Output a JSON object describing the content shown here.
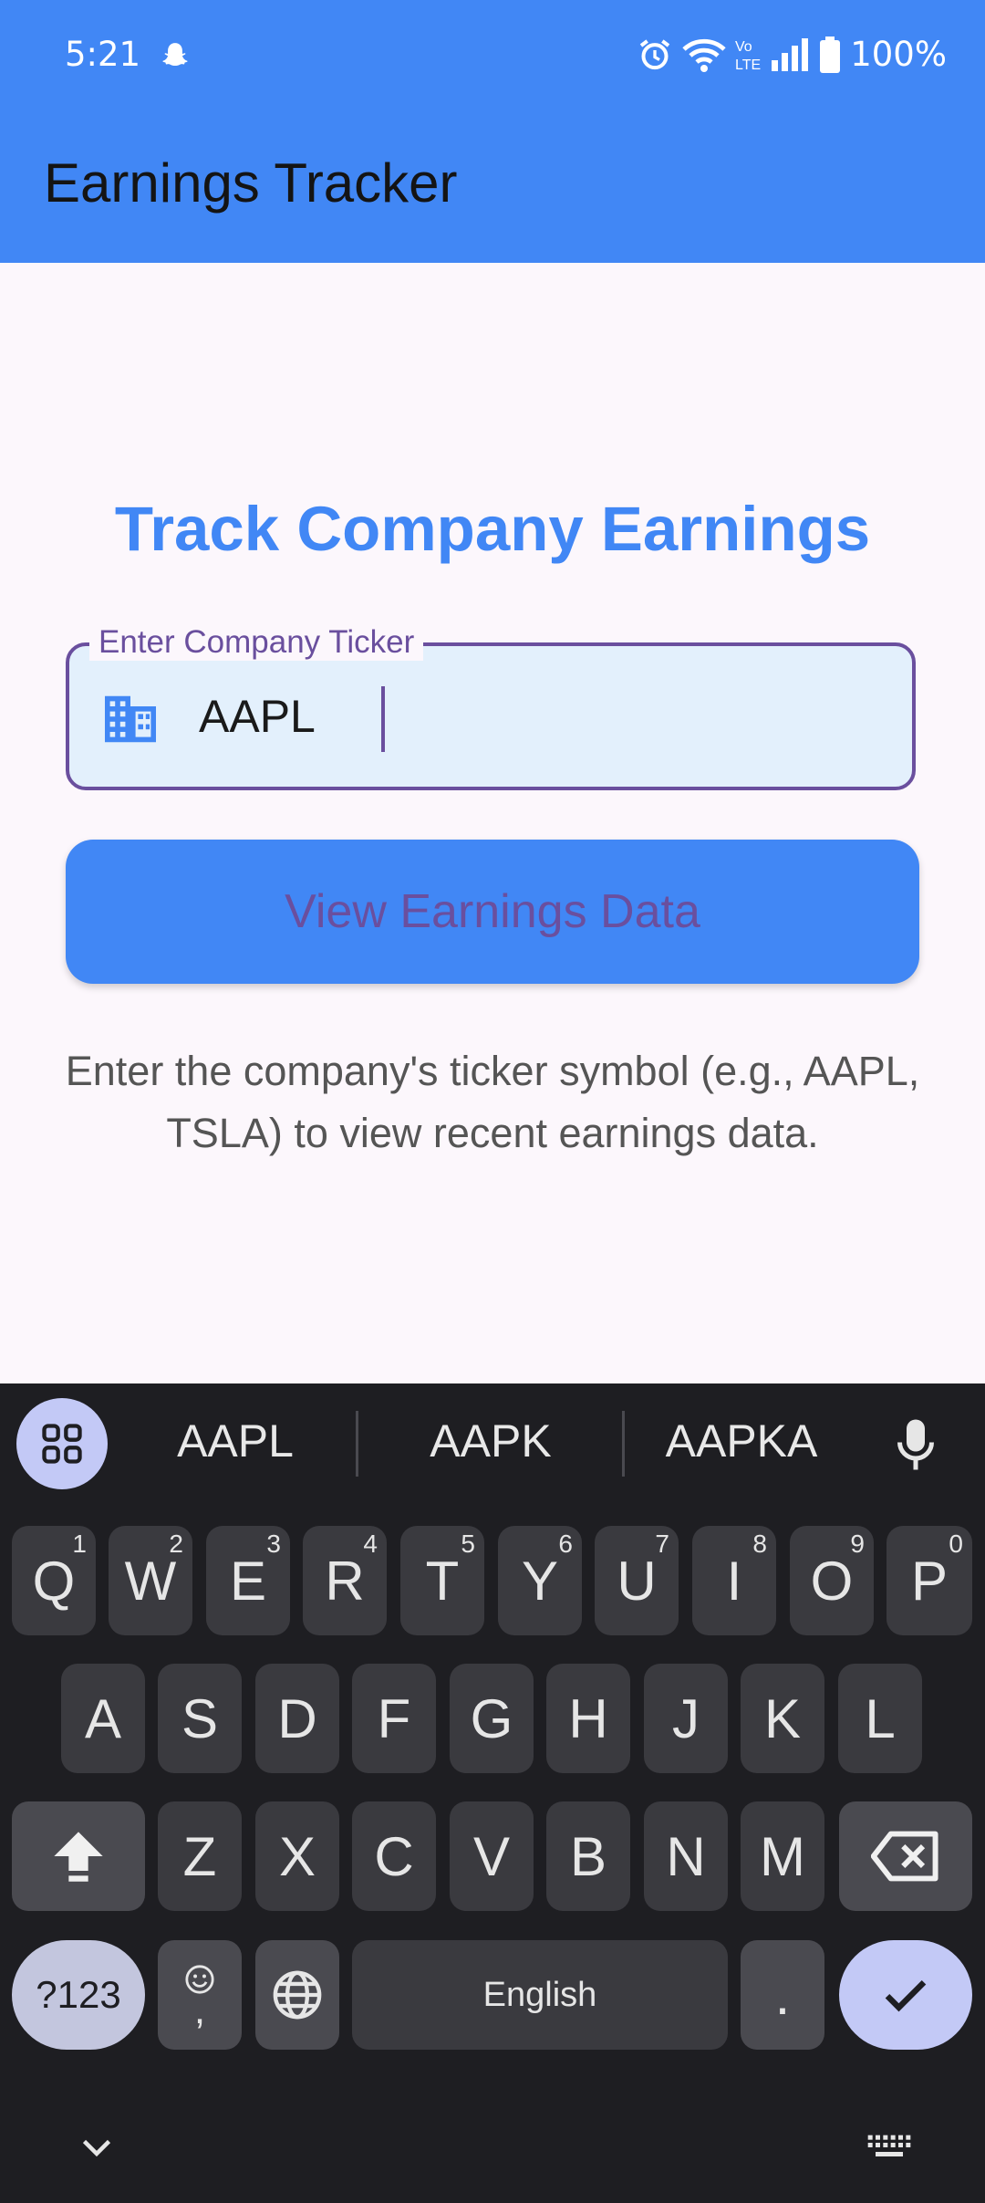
{
  "status_bar": {
    "time": "5:21",
    "battery": "100%",
    "icons": [
      "snapchat-icon",
      "alarm-icon",
      "wifi-icon",
      "volte-icon",
      "signal-icon",
      "battery-icon"
    ]
  },
  "app_bar": {
    "title": "Earnings Tracker"
  },
  "main": {
    "heading": "Track Company Earnings",
    "ticker_field": {
      "label": "Enter Company Ticker",
      "value": "AAPL",
      "icon": "building-icon"
    },
    "view_button_label": "View Earnings Data",
    "help_text": "Enter the company's ticker symbol (e.g., AAPL, TSLA) to view recent earnings data."
  },
  "keyboard": {
    "suggestions": [
      "AAPL",
      "AAPK",
      "AAPKA"
    ],
    "row1": [
      {
        "k": "Q",
        "s": "1"
      },
      {
        "k": "W",
        "s": "2"
      },
      {
        "k": "E",
        "s": "3"
      },
      {
        "k": "R",
        "s": "4"
      },
      {
        "k": "T",
        "s": "5"
      },
      {
        "k": "Y",
        "s": "6"
      },
      {
        "k": "U",
        "s": "7"
      },
      {
        "k": "I",
        "s": "8"
      },
      {
        "k": "O",
        "s": "9"
      },
      {
        "k": "P",
        "s": "0"
      }
    ],
    "row2": [
      "A",
      "S",
      "D",
      "F",
      "G",
      "H",
      "J",
      "K",
      "L"
    ],
    "row3": [
      "Z",
      "X",
      "C",
      "V",
      "B",
      "N",
      "M"
    ],
    "symbols_key": "?123",
    "comma_key": ",",
    "space_label": "English",
    "period_key": "."
  },
  "colors": {
    "primary": "#4187F5",
    "accent_purple": "#6A4F9E",
    "field_fill": "#E3F0FC",
    "keyboard_bg": "#1E1E22"
  }
}
